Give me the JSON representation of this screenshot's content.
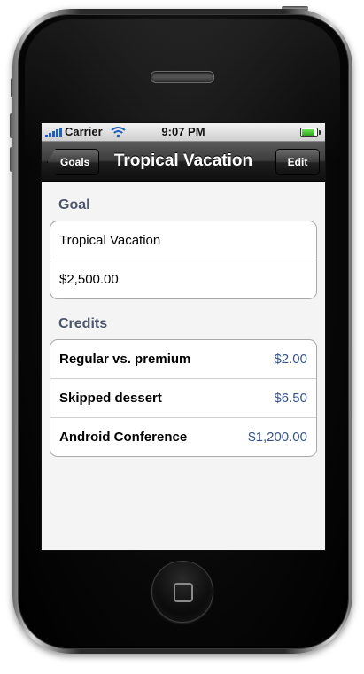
{
  "status_bar": {
    "carrier": "Carrier",
    "time": "9:07 PM"
  },
  "nav_bar": {
    "back_label": "Goals",
    "title": "Tropical Vacation",
    "edit_label": "Edit"
  },
  "goal_section": {
    "header": "Goal",
    "rows": [
      {
        "text": "Tropical Vacation"
      },
      {
        "text": "$2,500.00"
      }
    ]
  },
  "credits_section": {
    "header": "Credits",
    "rows": [
      {
        "label": "Regular vs. premium",
        "amount": "$2.00"
      },
      {
        "label": "Skipped dessert",
        "amount": "$6.50"
      },
      {
        "label": "Android Conference",
        "amount": "$1,200.00"
      }
    ]
  },
  "colors": {
    "section_header": "#4c566c",
    "value_text": "#385487",
    "nav_bar": "#1f1f1f"
  },
  "icons": [
    "signal-icon",
    "wifi-icon",
    "battery-icon",
    "back-chevron-icon",
    "home-square-icon"
  ]
}
